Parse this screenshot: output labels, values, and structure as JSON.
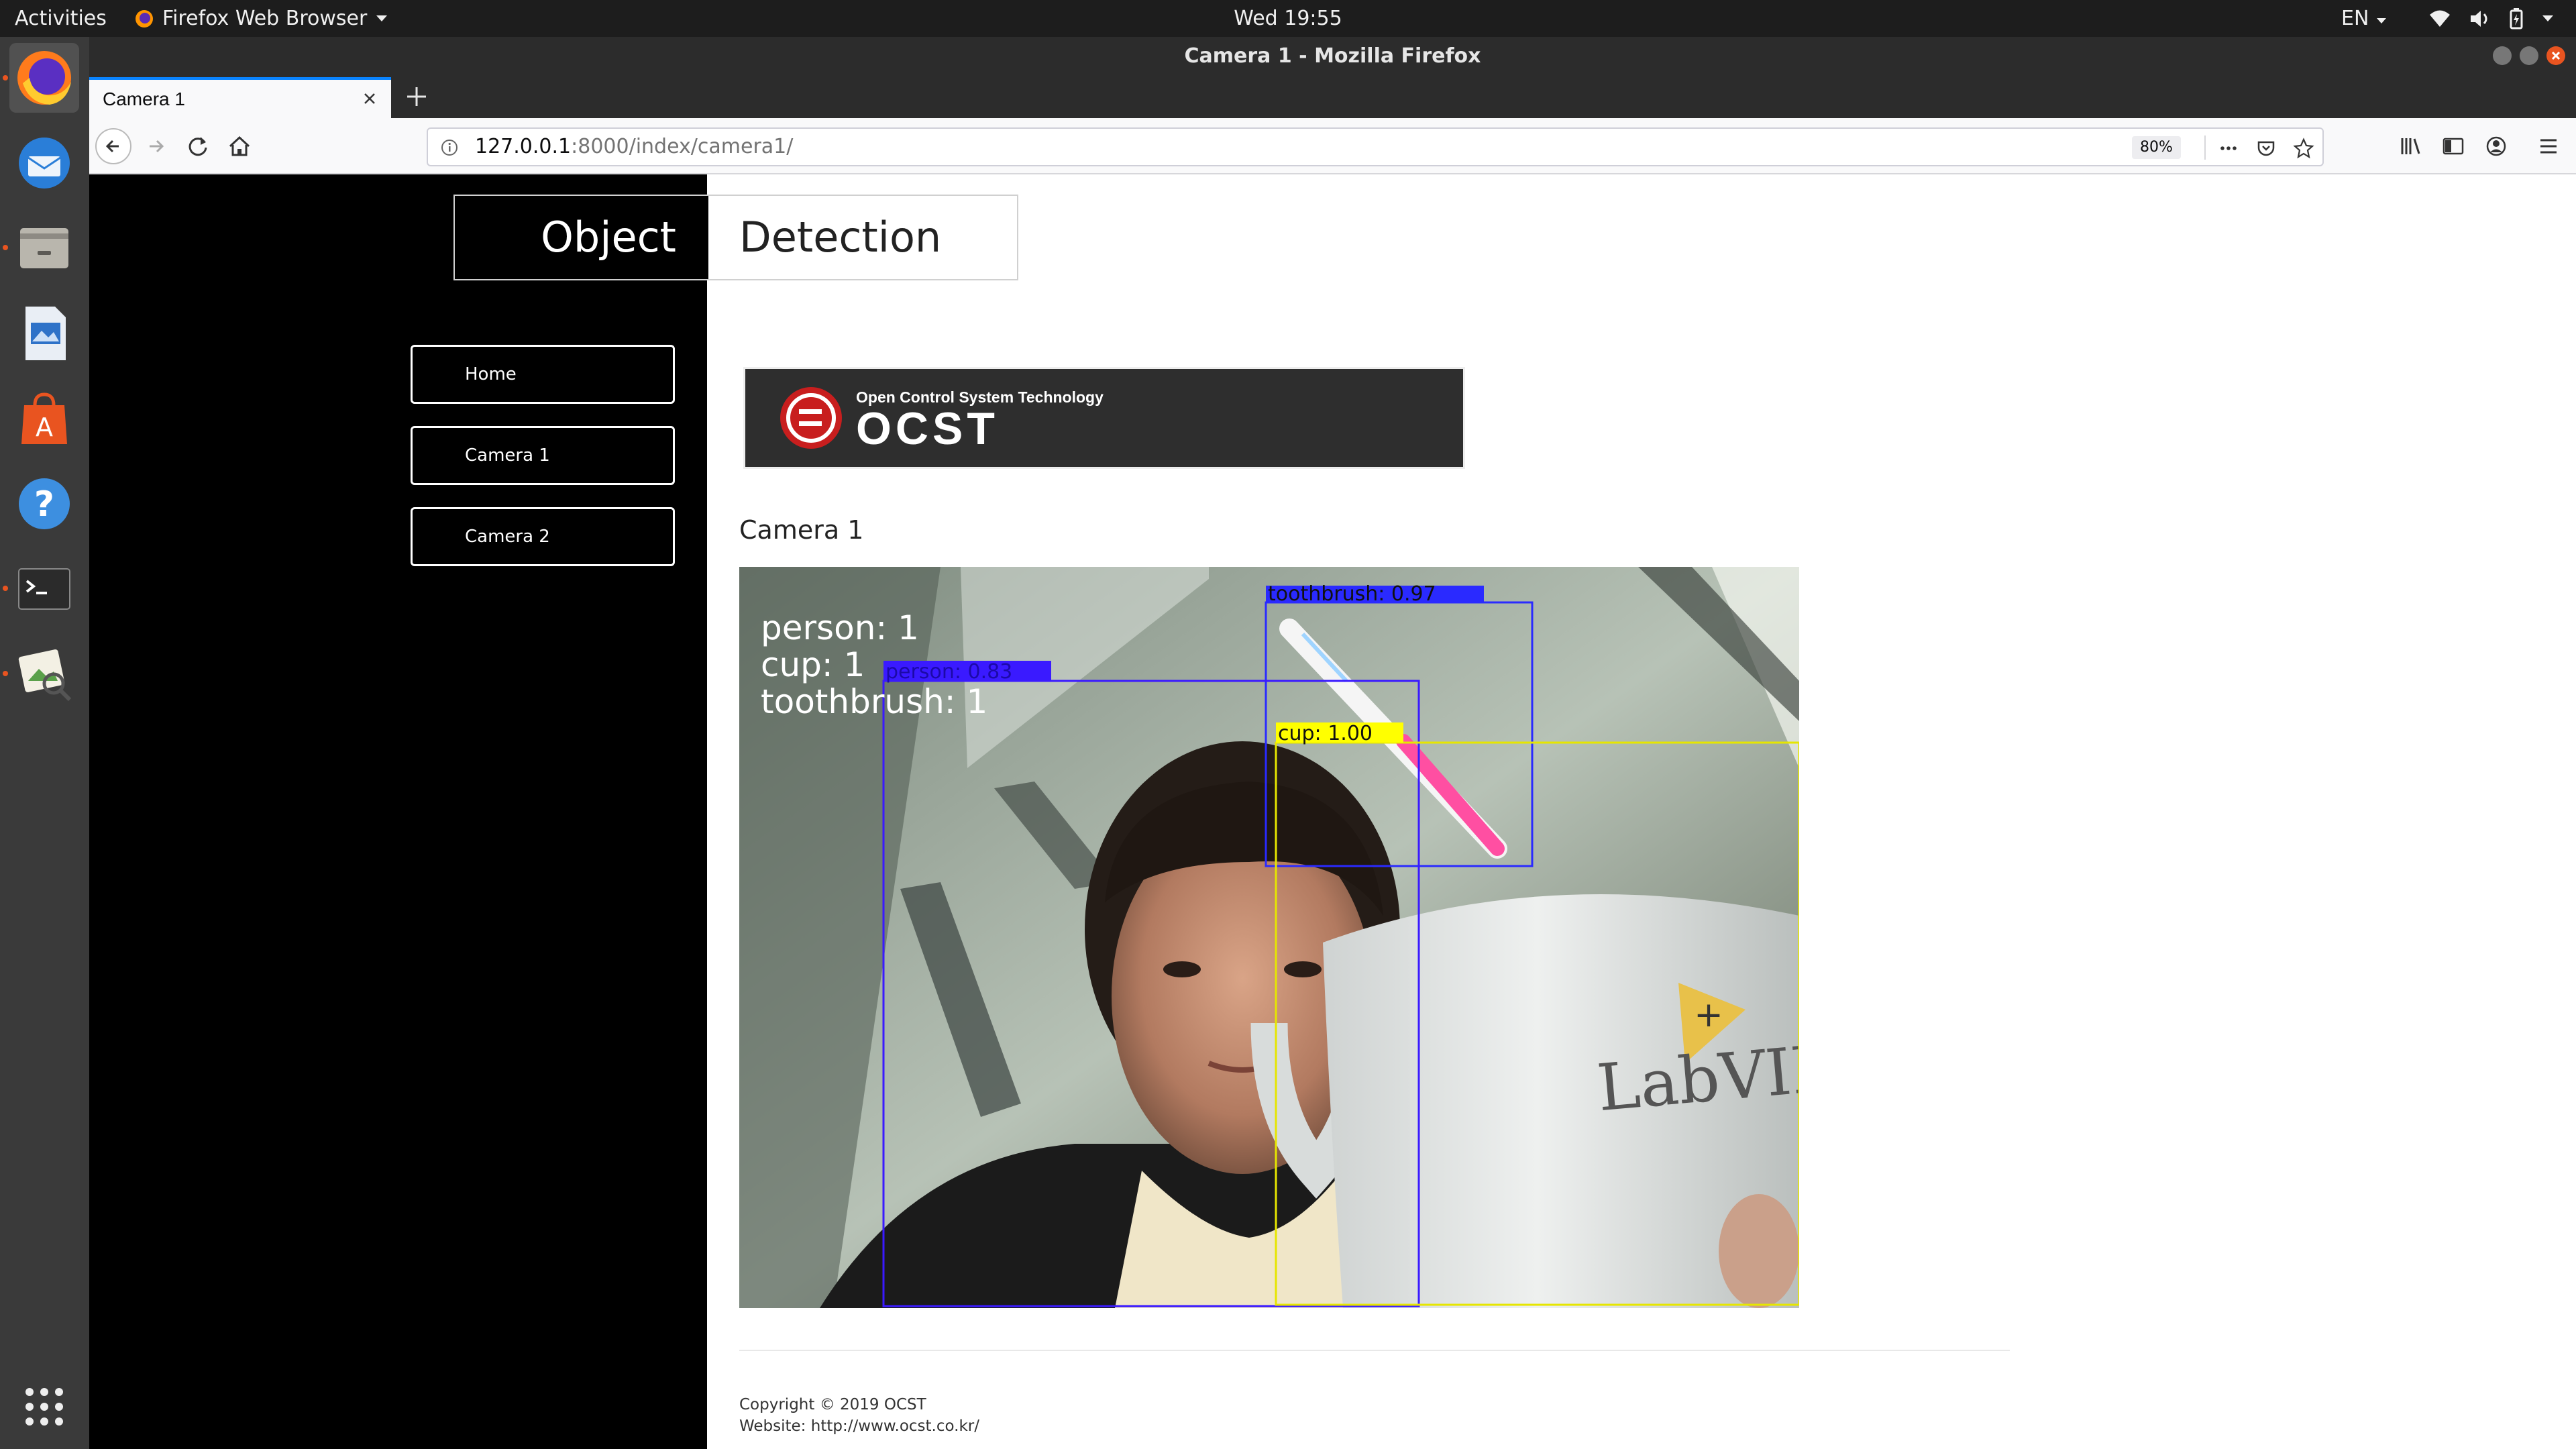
{
  "topbar": {
    "activities": "Activities",
    "app_menu": "Firefox Web Browser",
    "clock": "Wed 19:55",
    "language": "EN",
    "tray_icons": [
      "wifi-icon",
      "volume-icon",
      "battery-icon",
      "system-menu-icon"
    ]
  },
  "dock": {
    "apps": [
      "Firefox",
      "Thunderbird",
      "Files",
      "LibreOffice Impress",
      "Ubuntu Software",
      "Help",
      "Terminal",
      "Image Viewer"
    ],
    "show_apps": "show-applications-icon"
  },
  "window": {
    "title": "Camera 1 - Mozilla Firefox"
  },
  "browser": {
    "tab_title": "Camera 1",
    "url_host": "127.0.0.1",
    "url_path": ":8000/index/camera1/",
    "zoom": "80%"
  },
  "page": {
    "header_left": "Object",
    "header_right": "Detection",
    "menu": [
      "Home",
      "Camera 1",
      "Camera 2"
    ],
    "logo_tagline": "Open Control System Technology",
    "logo_text": "OCST",
    "camera_title": "Camera 1",
    "overlay_counts": [
      "person:  1",
      "cup:  1",
      "toothbrush:  1"
    ],
    "detections": [
      {
        "label": "toothbrush:  0.97",
        "color": "#2a2aff"
      },
      {
        "label": "person:  0.83",
        "color": "#3a1aff"
      },
      {
        "label": "cup:  1.00",
        "color": "#ffff00"
      }
    ],
    "mug_text": "LabVIE",
    "footer_copyright": "Copyright © 2019 OCST",
    "footer_website": "Website: http://www.ocst.co.kr/"
  },
  "colors": {
    "ubuntu_orange": "#e95420",
    "firefox_blue": "#0a84ff",
    "sidebar": "#000000"
  }
}
